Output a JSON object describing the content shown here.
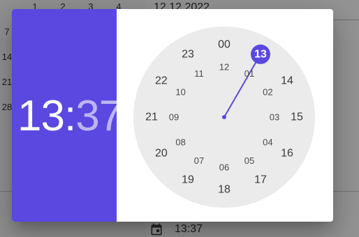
{
  "background": {
    "calendar_numbers": [
      {
        "text": "1"
      },
      {
        "text": "2"
      },
      {
        "text": "3"
      },
      {
        "text": "4"
      },
      {
        "text": "7"
      },
      {
        "text": "14"
      },
      {
        "text": "21"
      },
      {
        "text": "28"
      }
    ],
    "date_field_value": "12.12.2022",
    "time_field_value": "13:37",
    "calendar_icon": "calendar-icon"
  },
  "dialog": {
    "hour": "13",
    "separator": ":",
    "minute": "37",
    "accent_color": "#5a48e0",
    "selected_hour": "13",
    "outer_hours": [
      "00",
      "13",
      "14",
      "15",
      "16",
      "17",
      "18",
      "19",
      "20",
      "21",
      "22",
      "23"
    ],
    "inner_hours": [
      "12",
      "01",
      "02",
      "03",
      "04",
      "05",
      "06",
      "07",
      "08",
      "09",
      "10",
      "11"
    ]
  }
}
